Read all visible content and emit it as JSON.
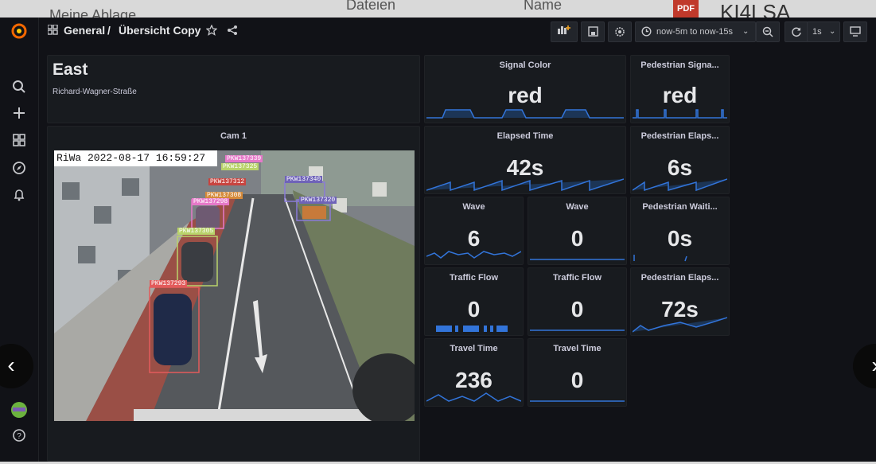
{
  "background": {
    "folder_label": "Meine Ablage",
    "col_files": "Dateien",
    "col_name": "Name",
    "pdf_badge": "PDF",
    "file_title": "KI4LSA"
  },
  "sidebar": {
    "icons": [
      "grafana-logo-icon",
      "search-icon",
      "plus-icon",
      "dashboards-icon",
      "explore-icon",
      "alerting-bell-icon",
      "avatar",
      "help-icon"
    ]
  },
  "topbar": {
    "breadcrumb_folder": "General",
    "breadcrumb_sep": "/",
    "breadcrumb_dashboard": "Übersicht Copy",
    "time_range": "now-5m to now-15s",
    "refresh_interval": "1s"
  },
  "panels": {
    "header": {
      "title": "East",
      "subtitle": "Richard-Wagner-Straße"
    },
    "cam": {
      "title": "Cam 1",
      "timestamp": "RiWa 2022-08-17 16:59:27",
      "detections": [
        "PKW137339",
        "PKW137325",
        "PKW137312",
        "PKW137308",
        "PKW137298",
        "PKW137305",
        "PKW137293",
        "PKW137340",
        "PKW137320"
      ]
    },
    "signal_color": {
      "title": "Signal Color",
      "value": "red"
    },
    "ped_signal": {
      "title": "Pedestrian Signa...",
      "value": "red"
    },
    "elapsed_time": {
      "title": "Elapsed Time",
      "value": "42s"
    },
    "ped_elapsed_1": {
      "title": "Pedestrian Elaps...",
      "value": "6s"
    },
    "wave_1": {
      "title": "Wave",
      "value": "6"
    },
    "wave_2": {
      "title": "Wave",
      "value": "0"
    },
    "ped_waiting": {
      "title": "Pedestrian Waiti...",
      "value": "0s"
    },
    "flow_1": {
      "title": "Traffic Flow",
      "value": "0"
    },
    "flow_2": {
      "title": "Traffic Flow",
      "value": "0"
    },
    "ped_elapsed_2": {
      "title": "Pedestrian Elaps...",
      "value": "72s"
    },
    "travel_1": {
      "title": "Travel Time",
      "value": "236"
    },
    "travel_2": {
      "title": "Travel Time",
      "value": "0"
    }
  },
  "colors": {
    "accent_blue": "#3274d9",
    "panel_bg": "#181b1f",
    "page_bg": "#111217",
    "grafana_orange": "#f46800"
  }
}
